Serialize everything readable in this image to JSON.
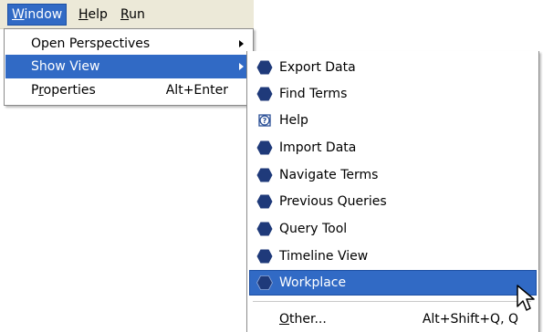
{
  "menubar": {
    "items": [
      {
        "pre": "",
        "mn": "W",
        "post": "indow"
      },
      {
        "pre": "",
        "mn": "H",
        "post": "elp"
      },
      {
        "pre": "",
        "mn": "R",
        "post": "un"
      }
    ]
  },
  "window_menu": {
    "items": [
      {
        "label": "Open Perspectives",
        "accel": ""
      },
      {
        "label": "Show View",
        "accel": ""
      },
      {
        "pre": "P",
        "mn": "r",
        "post": "operties",
        "accel": "Alt+Enter"
      }
    ]
  },
  "show_view_menu": {
    "items": [
      {
        "label": "Export Data",
        "icon": "hexagon-view-icon"
      },
      {
        "label": "Find Terms",
        "icon": "hexagon-view-icon"
      },
      {
        "label": "Help",
        "icon": "help-icon"
      },
      {
        "label": "Import Data",
        "icon": "hexagon-view-icon"
      },
      {
        "label": "Navigate Terms",
        "icon": "hexagon-view-icon"
      },
      {
        "label": "Previous Queries",
        "icon": "hexagon-view-icon"
      },
      {
        "label": "Query Tool",
        "icon": "hexagon-view-icon"
      },
      {
        "label": "Timeline View",
        "icon": "hexagon-view-icon"
      },
      {
        "label": "Workplace",
        "icon": "hexagon-view-icon"
      }
    ],
    "other": {
      "pre": "",
      "mn": "O",
      "post": "ther...",
      "accel": "Alt+Shift+Q, Q"
    }
  },
  "colors": {
    "highlight": "#316ac5",
    "icon": "#1f3a7a",
    "menubar": "#ece9d8"
  }
}
